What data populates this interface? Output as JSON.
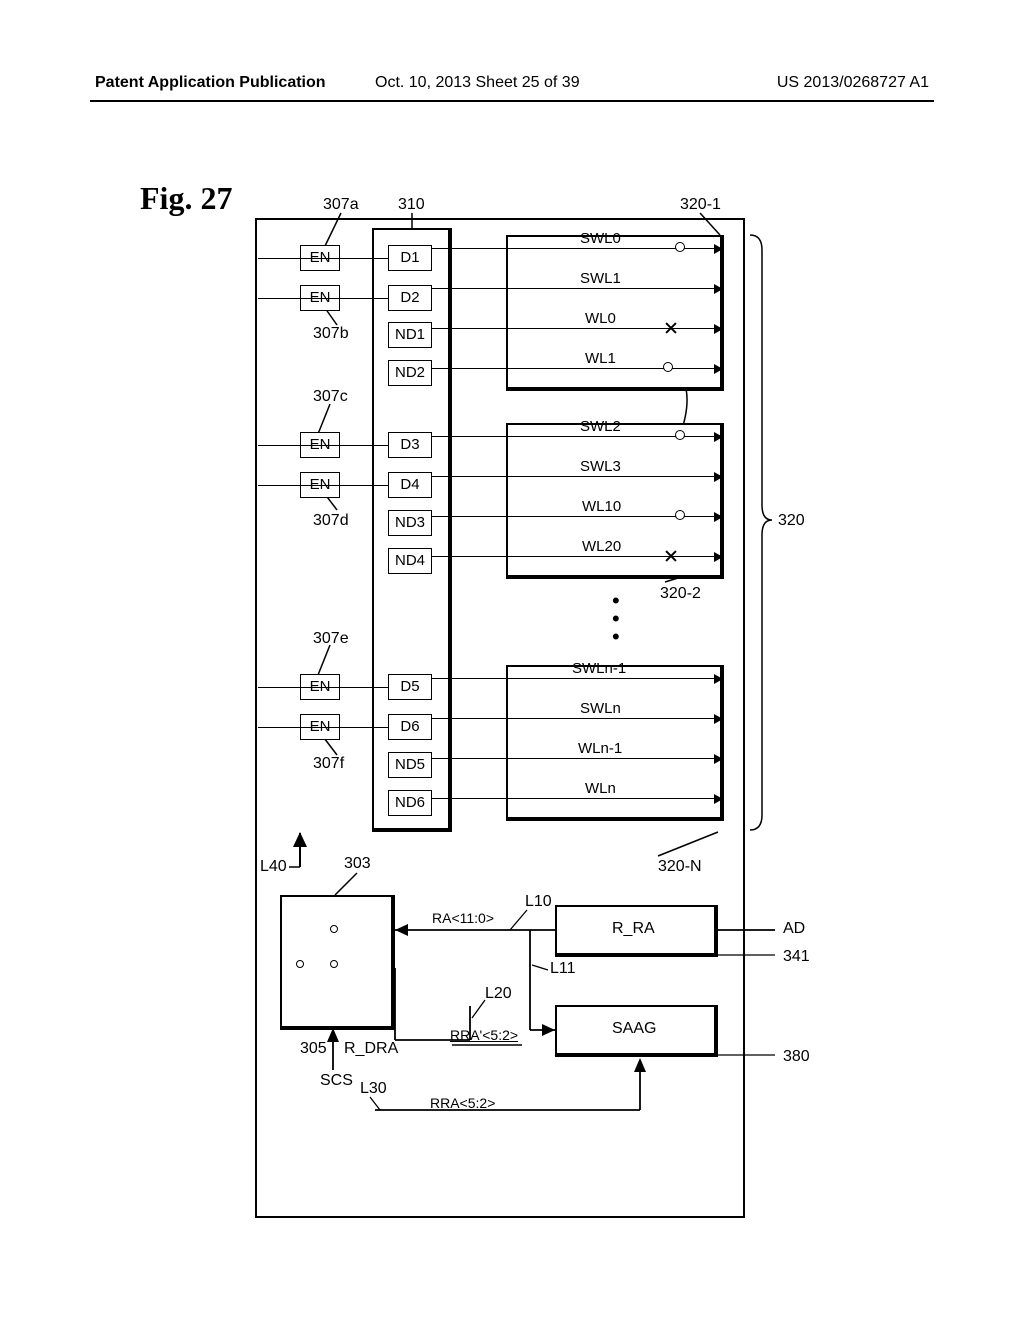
{
  "header": {
    "left": "Patent Application Publication",
    "mid": "Oct. 10, 2013  Sheet 25 of 39",
    "right": "US 2013/0268727 A1"
  },
  "figure_title": "Fig. 27",
  "refs": {
    "r307a": "307a",
    "r307b": "307b",
    "r307c": "307c",
    "r307d": "307d",
    "r307e": "307e",
    "r307f": "307f",
    "r310": "310",
    "r320_1": "320-1",
    "r320_2": "320-2",
    "r320_N": "320-N",
    "r320": "320",
    "r303": "303",
    "r305": "305",
    "r341": "341",
    "r380": "380",
    "L10": "L10",
    "L11": "L11",
    "L20": "L20",
    "L30": "L30",
    "L40": "L40"
  },
  "en": "EN",
  "d": {
    "D1": "D1",
    "D2": "D2",
    "D3": "D3",
    "D4": "D4",
    "D5": "D5",
    "D6": "D6",
    "ND1": "ND1",
    "ND2": "ND2",
    "ND3": "ND3",
    "ND4": "ND4",
    "ND5": "ND5",
    "ND6": "ND6"
  },
  "wl": {
    "SWL0": "SWL0",
    "SWL1": "SWL1",
    "WL0": "WL0",
    "WL1": "WL1",
    "SWL2": "SWL2",
    "SWL3": "SWL3",
    "WL10": "WL10",
    "WL20": "WL20",
    "SWLn1": "SWLn-1",
    "SWLn": "SWLn",
    "WLn1": "WLn-1",
    "WLn": "WLn"
  },
  "sig": {
    "RA": "RA<11:0>",
    "R_RA": "R_RA",
    "AD": "AD",
    "R_DRA": "R_DRA",
    "SCS": "SCS",
    "SAAG": "SAAG",
    "RRA52": "RRA<5:2>",
    "RRAp52": "RRA'<5:2>"
  }
}
